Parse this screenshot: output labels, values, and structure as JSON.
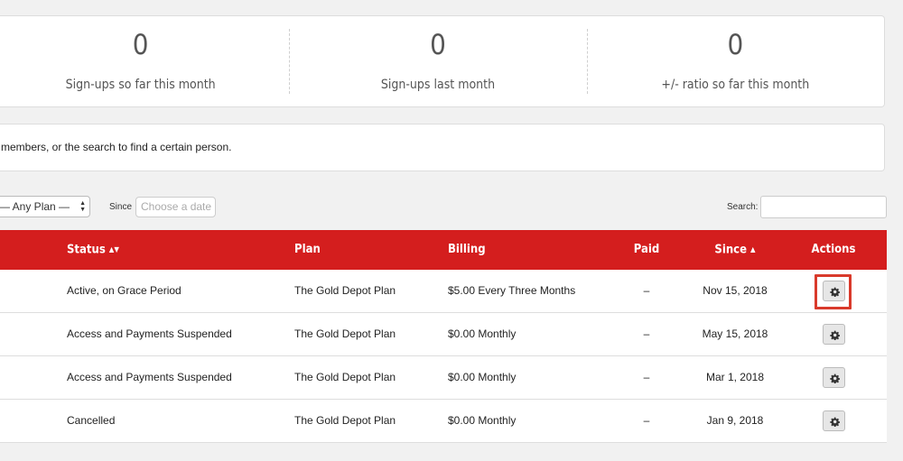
{
  "stats": [
    {
      "value": "0",
      "label": "Sign-ups so far this month"
    },
    {
      "value": "0",
      "label": "Sign-ups last month"
    },
    {
      "value": "0",
      "label": "+/- ratio so far this month"
    }
  ],
  "info": {
    "text": "members, or the search to find a certain person."
  },
  "filters": {
    "plan_selected": "— Any Plan —",
    "since_label": "Since",
    "since_placeholder": "Choose a date",
    "search_label": "Search:"
  },
  "table": {
    "headers": {
      "status": "Status",
      "plan": "Plan",
      "billing": "Billing",
      "paid": "Paid",
      "since": "Since",
      "actions": "Actions"
    },
    "rows": [
      {
        "status": "Active, on Grace Period",
        "plan": "The Gold Depot Plan",
        "billing": "$5.00 Every Three Months",
        "paid": "–",
        "since": "Nov 15, 2018"
      },
      {
        "status": "Access and Payments Suspended",
        "plan": "The Gold Depot Plan",
        "billing": "$0.00 Monthly",
        "paid": "–",
        "since": "May 15, 2018"
      },
      {
        "status": "Access and Payments Suspended",
        "plan": "The Gold Depot Plan",
        "billing": "$0.00 Monthly",
        "paid": "–",
        "since": "Mar 1, 2018"
      },
      {
        "status": "Cancelled",
        "plan": "The Gold Depot Plan",
        "billing": "$0.00 Monthly",
        "paid": "–",
        "since": "Jan 9, 2018"
      }
    ]
  },
  "icons": {
    "row_action": "gear-icon",
    "sort_status": "sort-both-icon",
    "sort_since": "sort-asc-icon"
  },
  "colors": {
    "header_bg": "#d41e1e",
    "highlight": "#d93a2b"
  }
}
